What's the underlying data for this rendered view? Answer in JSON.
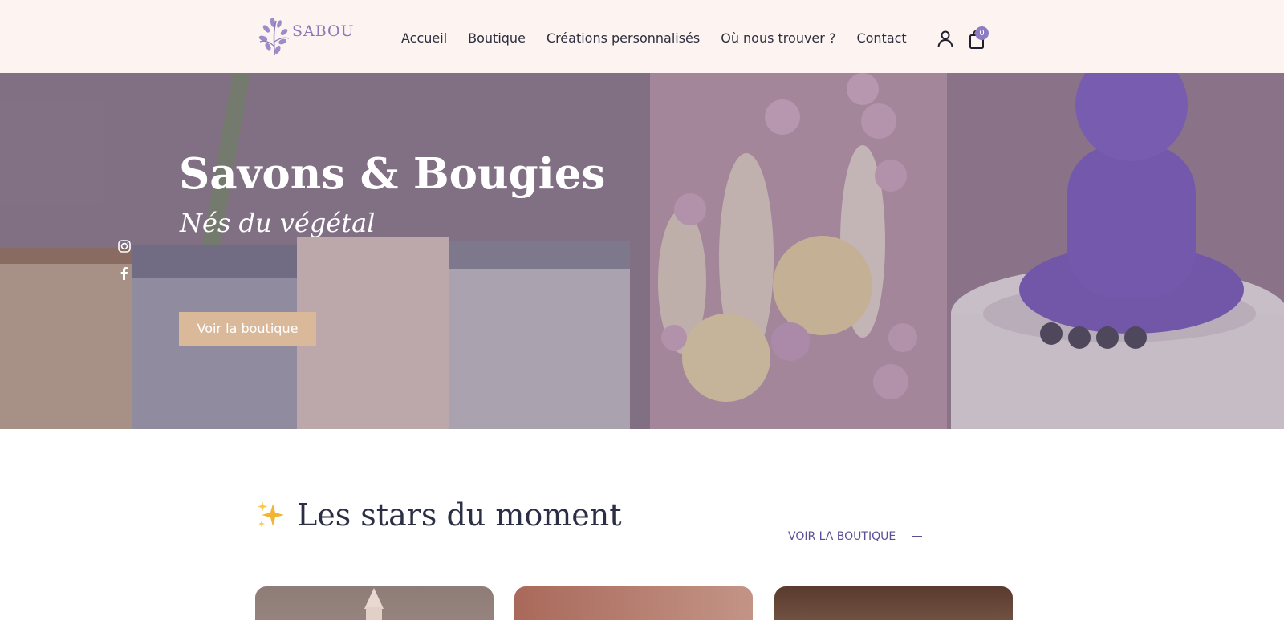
{
  "brand": {
    "name": "SABOU",
    "logo_icon": "lavender-flower-icon",
    "accent": "#8d7bc4"
  },
  "nav": {
    "items": [
      {
        "label": "Accueil"
      },
      {
        "label": "Boutique"
      },
      {
        "label": "Créations personnalisés"
      },
      {
        "label": "Où nous trouver ?"
      },
      {
        "label": "Contact"
      }
    ]
  },
  "header": {
    "account_icon": "user-icon",
    "cart_icon": "shopping-bag-icon",
    "cart_count": "0"
  },
  "hero": {
    "title": "Savons & Bougies",
    "subtitle": "Nés du végétal",
    "cta_label": "Voir la boutique",
    "cta_color": "#d9b99a",
    "social_icons": [
      "instagram-icon",
      "facebook-icon"
    ]
  },
  "section": {
    "title": "Les stars du moment",
    "title_icon": "sparkles-icon",
    "link_label": "VOIR LA BOUTIQUE"
  },
  "products": [
    {
      "image": "product-candle-image"
    },
    {
      "image": "product-soap-image"
    },
    {
      "image": "product-box-image"
    }
  ]
}
